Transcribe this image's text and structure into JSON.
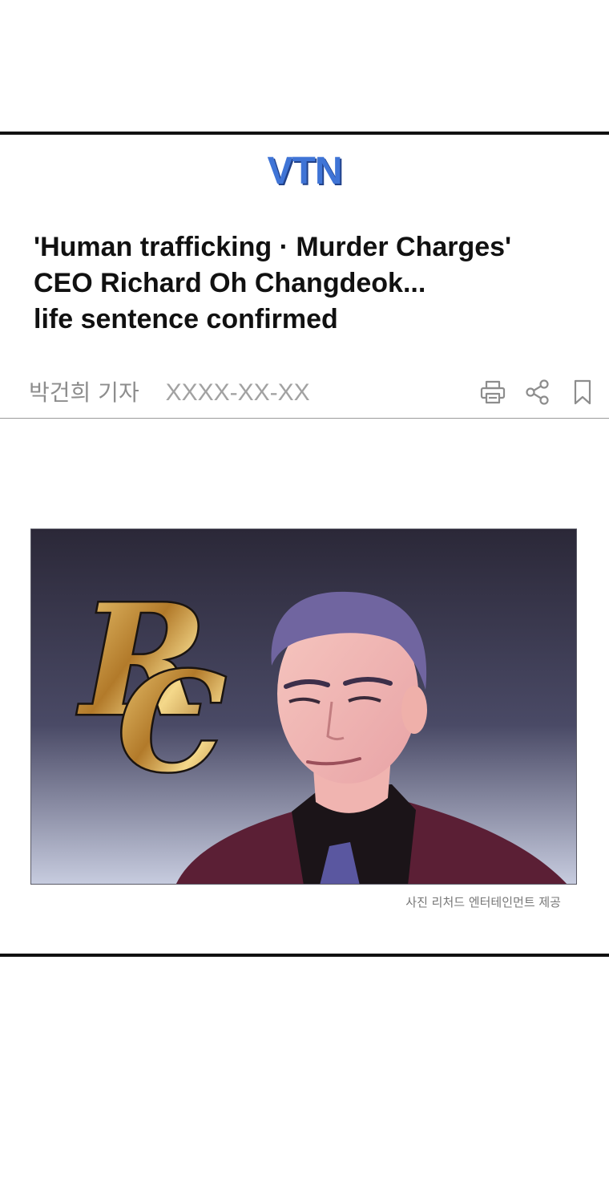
{
  "article": {
    "outlet": "VTN",
    "headline": [
      "'Human trafficking · Murder Charges'",
      "CEO Richard Oh Changdeok...",
      "life sentence confirmed"
    ],
    "reporter": "박건희 기자",
    "date": "XXXX-XX-XX",
    "photo": {
      "monogram": "RC",
      "caption": "사진 리처드 엔터테인먼트 제공"
    }
  },
  "icons": [
    "print-icon",
    "share-icon",
    "bookmark-icon"
  ],
  "colors": {
    "logo": "#3f74d6",
    "logo_shadow": "#22428a",
    "headline": "#111111",
    "byline": "#8d8d8d",
    "photo_bg_top": "#2b2838",
    "photo_bg_bottom": "#c8cde0",
    "monogram_gold": "#d8a94a"
  }
}
